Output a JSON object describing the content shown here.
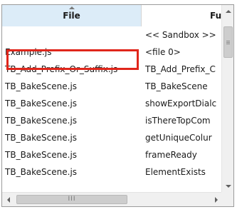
{
  "columns": {
    "file": "File",
    "function": "Functic"
  },
  "rows": [
    {
      "file": "",
      "func": "<< Sandbox >>"
    },
    {
      "file": "Example.js",
      "func": "<file 0>"
    },
    {
      "file": "TB_Add_Prefix_Or_Suffix.js",
      "func": "TB_Add_Prefix_C"
    },
    {
      "file": "TB_BakeScene.js",
      "func": "TB_BakeScene"
    },
    {
      "file": "TB_BakeScene.js",
      "func": "showExportDialc"
    },
    {
      "file": "TB_BakeScene.js",
      "func": "isThereTopCom"
    },
    {
      "file": "TB_BakeScene.js",
      "func": "getUniqueColur"
    },
    {
      "file": "TB_BakeScene.js",
      "func": "frameReady"
    },
    {
      "file": "TB_BakeScene.js",
      "func": "ElementExists"
    }
  ],
  "hscroll_grip": "III",
  "colors": {
    "highlight": "#e0261b",
    "sorted_header": "#dcecf8"
  }
}
